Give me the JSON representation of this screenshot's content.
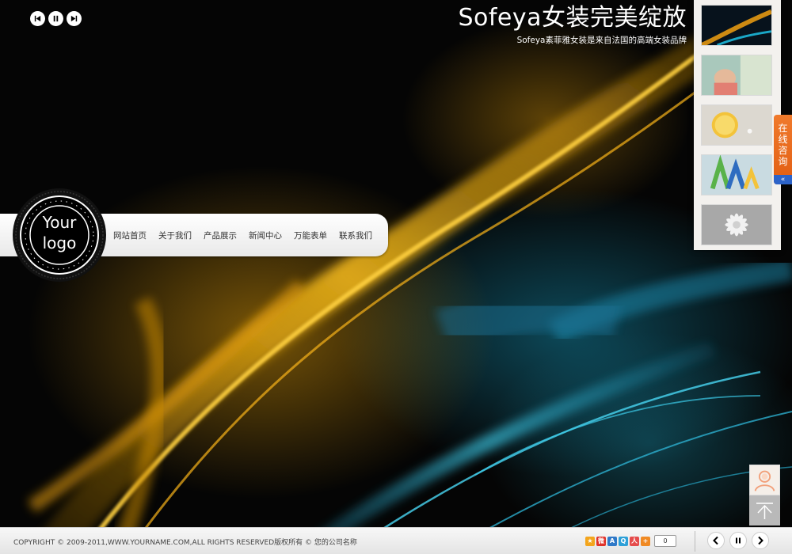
{
  "header": {
    "title": "Sofeya女装完美绽放",
    "subtitle": "Sofeya素菲雅女装是来自法国的高端女装品牌"
  },
  "slideshow_controls": {
    "prev_icon": "skip-previous-icon",
    "pause_icon": "pause-icon",
    "next_icon": "skip-next-icon"
  },
  "logo": {
    "line1": "Your",
    "line2": "logo"
  },
  "nav": {
    "items": [
      {
        "label": "网站首页"
      },
      {
        "label": "关于我们"
      },
      {
        "label": "产品展示"
      },
      {
        "label": "新闻中心"
      },
      {
        "label": "万能表单"
      },
      {
        "label": "联系我们"
      }
    ]
  },
  "thumbnails": [
    {
      "name": "abstract-lights",
      "colors": [
        "#0b1b2a",
        "#f0a010",
        "#1aa8c8"
      ]
    },
    {
      "name": "child-outdoor",
      "colors": [
        "#7bb3a4",
        "#d8e4d0",
        "#e27f73"
      ]
    },
    {
      "name": "lemon-slice",
      "colors": [
        "#dcd8d0",
        "#f3c33a",
        "#ffffff"
      ]
    },
    {
      "name": "letters-aa",
      "colors": [
        "#c9dbe1",
        "#59b24a",
        "#2e6cc0"
      ]
    },
    {
      "name": "daisy-flower",
      "colors": [
        "#a8a8a8",
        "#f2f2f2",
        "#d0d0d0"
      ]
    }
  ],
  "consult_tab": {
    "label": "在线咨询",
    "arrow": "«"
  },
  "side_buttons": {
    "avatar_icon": "user-avatar-icon",
    "top_icon": "back-to-top-icon"
  },
  "footer": {
    "copyright": "COPYRIGHT © 2009-2011,WWW.YOURNAME.COM,ALL RIGHTS RESERVED版权所有 © 您的公司名称",
    "share_icons": [
      {
        "name": "qzone-star-icon",
        "color": "#f3a51d",
        "glyph": "★"
      },
      {
        "name": "sina-weibo-icon",
        "color": "#e0322a",
        "glyph": "微"
      },
      {
        "name": "kaixin-icon",
        "color": "#2f79c8",
        "glyph": "A"
      },
      {
        "name": "tencent-weibo-icon",
        "color": "#2ea0d8",
        "glyph": "Q"
      },
      {
        "name": "renren-icon",
        "color": "#e54b4b",
        "glyph": "人"
      },
      {
        "name": "more-share-icon",
        "color": "#f08a24",
        "glyph": "+"
      }
    ],
    "share_count": "0",
    "controls": {
      "prev_icon": "chevron-left-icon",
      "pause_icon": "pause-icon",
      "next_icon": "chevron-right-icon"
    }
  }
}
